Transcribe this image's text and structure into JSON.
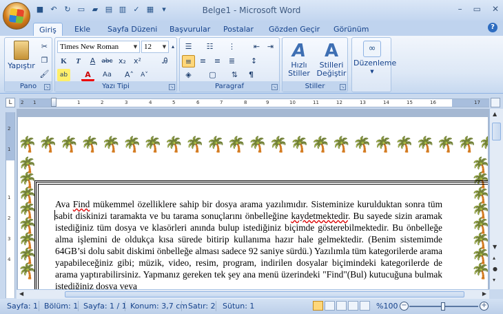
{
  "window": {
    "title": "Belge1 - Microsoft Word"
  },
  "tabs": [
    "Giriş",
    "Ekle",
    "Sayfa Düzeni",
    "Başvurular",
    "Postalar",
    "Gözden Geçir",
    "Görünüm"
  ],
  "ribbon": {
    "clipboard": {
      "label": "Pano",
      "paste": "Yapıştır"
    },
    "font": {
      "label": "Yazı Tipi",
      "name": "Times New Roman",
      "size": "12"
    },
    "paragraph": {
      "label": "Paragraf"
    },
    "styles": {
      "label": "Stiller",
      "quick": "Hızlı\nStiller",
      "change": "Stilleri\nDeğiştir"
    },
    "editing": {
      "label": "Düzenleme"
    }
  },
  "ruler": {
    "numbers": [
      "1",
      "2",
      "1",
      "2",
      "3",
      "4",
      "5",
      "6",
      "7",
      "8",
      "9",
      "10",
      "11",
      "12",
      "13",
      "14",
      "15",
      "16",
      "17"
    ]
  },
  "document": {
    "segments": [
      {
        "text": "Ava ",
        "err": false
      },
      {
        "text": "Find",
        "err": true
      },
      {
        "text": " mükemmel özelliklere sahip bir dosya arama yazılımıdır. Sisteminize kurulduktan sonra tüm sabit diskinizi taramakta ve bu tarama sonuçlarını önbelleğine ",
        "err": false
      },
      {
        "text": "kaydetmektedir",
        "err": true
      },
      {
        "text": ". Bu sayede sizin aramak istediğiniz tüm dosya ve klasörleri anında bulup istediğiniz biçimde gösterebilmektedir. Bu önbelleğe alma işlemini de oldukça kısa sürede bitirip kullanıma hazır hale gelmektedir. (Benim sistemimde 64GB’si dolu sabit diskimi önbelleğe alması sadece 92 saniye sürdü.) Yazılımla tüm kategorilerde arama yapabileceğiniz gibi; müzik, video, resim, program, indirilen dosyalar biçimindeki kategorilerde de arama yaptırabilirsiniz. Yapmanız gereken tek şey ana menü üzerindeki \"Find\"(Bul) kutucuğuna bulmak istediğiniz dosya veya",
        "err": false
      }
    ]
  },
  "status": {
    "page": "Sayfa: 1",
    "section": "Bölüm: 1",
    "pages": "Sayfa: 1 / 1",
    "position": "Konum: 3,7 cm",
    "line": "Satır: 2",
    "column": "Sütun: 1",
    "zoom": "%100"
  }
}
